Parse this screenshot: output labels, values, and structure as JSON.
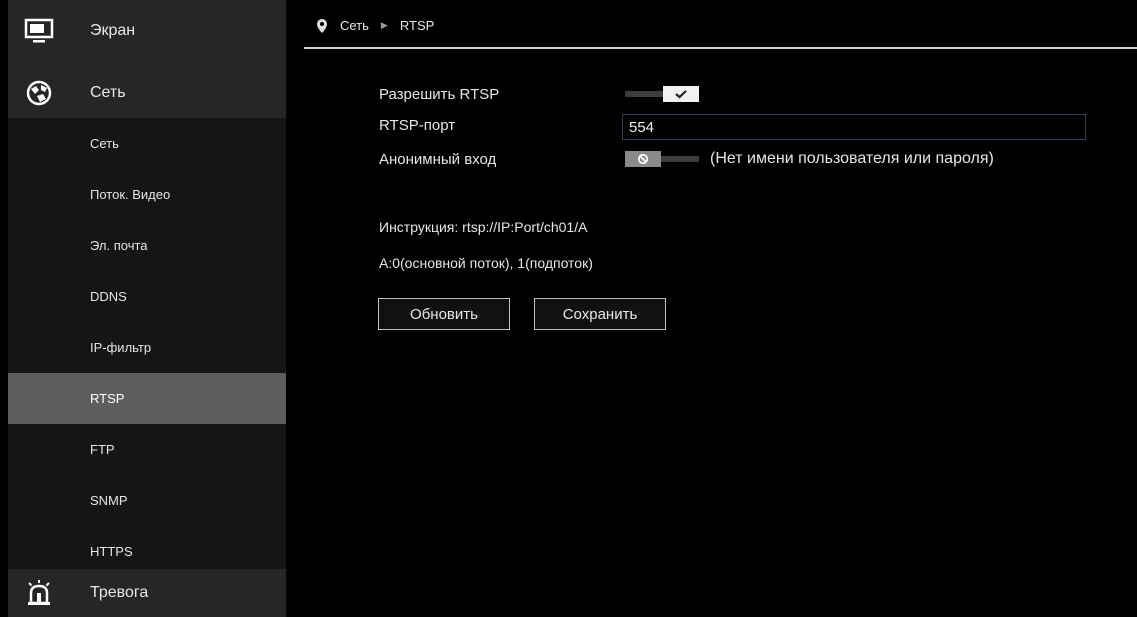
{
  "sidebar": {
    "top_items": [
      {
        "label": "Экран",
        "icon": "monitor-icon"
      },
      {
        "label": "Сеть",
        "icon": "network-globe-icon"
      },
      {
        "label": "Тревога",
        "icon": "alarm-icon"
      }
    ],
    "sub_items": [
      {
        "label": "Сеть"
      },
      {
        "label": "Поток. Видео"
      },
      {
        "label": "Эл. почта"
      },
      {
        "label": "DDNS"
      },
      {
        "label": "IP-фильтр"
      },
      {
        "label": "RTSP",
        "active": true
      },
      {
        "label": "FTP"
      },
      {
        "label": "SNMP"
      },
      {
        "label": "HTTPS"
      }
    ]
  },
  "breadcrumb": {
    "section": "Сеть",
    "page": "RTSP"
  },
  "form": {
    "enable_rtsp_label": "Разрешить RTSP",
    "enable_rtsp_on": true,
    "port_label": "RTSP-порт",
    "port_value": "554",
    "anon_label": "Анонимный вход",
    "anon_on": false,
    "anon_note": "(Нет имени пользователя или пароля)"
  },
  "info": {
    "instruction": "Инструкция: rtsp://IP:Port/ch01/A",
    "stream_note": "A:0(основной поток), 1(подпоток)"
  },
  "buttons": {
    "refresh": "Обновить",
    "save": "Сохранить"
  },
  "colors": {
    "sidebar_bg": "#1e1e1e",
    "active_bg": "#5e5e5e",
    "input_border": "#27425a"
  }
}
